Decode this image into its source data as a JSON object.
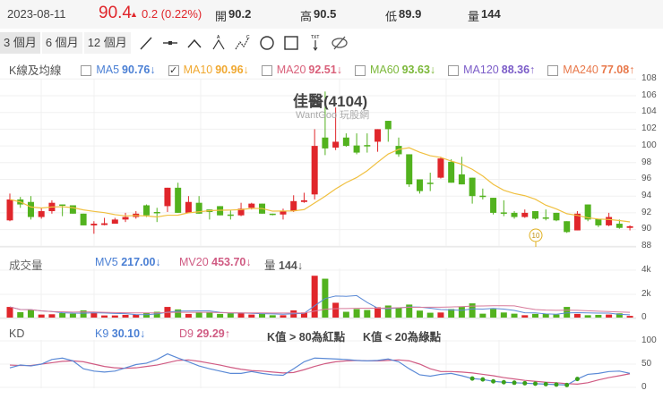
{
  "header": {
    "date": "2023-08-11",
    "price": "90.4",
    "change": "0.2 (0.22%)",
    "open_label": "開",
    "open": "90.2",
    "high_label": "高",
    "high": "90.5",
    "low_label": "低",
    "low": "89.9",
    "vol_label": "量",
    "vol": "144"
  },
  "toolbar": {
    "periods": [
      "3 個月",
      "6 個月",
      "12 個月"
    ],
    "selected": 0
  },
  "legend": {
    "title": "K線及均線",
    "items": [
      {
        "name": "MA5",
        "value": "90.76↓",
        "color": "#4a7fd4",
        "checked": false
      },
      {
        "name": "MA10",
        "value": "90.96↓",
        "color": "#f0a830",
        "checked": true
      },
      {
        "name": "MA20",
        "value": "92.51↓",
        "color": "#d9607a",
        "checked": false
      },
      {
        "name": "MA60",
        "value": "93.63↓",
        "color": "#7cb83a",
        "checked": false
      },
      {
        "name": "MA120",
        "value": "88.36↑",
        "color": "#7b5cc8",
        "checked": false
      },
      {
        "name": "MA240",
        "value": "77.08↑",
        "color": "#e8784a",
        "checked": false
      }
    ]
  },
  "chart": {
    "title": "佳醫(4104)",
    "watermark": "WantGoo 玩股網",
    "marker": "10",
    "price_ticks": [
      "108",
      "106",
      "104",
      "102",
      "100",
      "98",
      "96",
      "94",
      "92",
      "90",
      "88"
    ],
    "colors": {
      "up": "#e0262b",
      "down": "#52b21e",
      "flat": "#bbbbbb",
      "ma10": "#f0c040"
    }
  },
  "volume": {
    "title": "成交量",
    "mv5": "MV5",
    "mv5_value": "217.00↓",
    "mv20": "MV20",
    "mv20_value": "453.70↓",
    "vol_label": "量",
    "vol_value": "144↓",
    "ticks": [
      "4k",
      "2k",
      "0"
    ]
  },
  "kd": {
    "title": "KD",
    "k": "K9",
    "k_value": "30.10↓",
    "d": "D9",
    "d_value": "29.29↑",
    "note1": "K值 > 80為紅點",
    "note2": "K值 < 20為綠點",
    "ticks": [
      "100",
      "50",
      "0"
    ]
  },
  "chart_data": {
    "type": "candlestick",
    "ohlc": [
      [
        91.1,
        94.3,
        91.0,
        93.6
      ],
      [
        93.6,
        93.9,
        92.6,
        93.0
      ],
      [
        93.3,
        94.0,
        91.2,
        91.5
      ],
      [
        91.5,
        92.6,
        91.3,
        92.2
      ],
      [
        92.2,
        93.5,
        91.9,
        93.2
      ],
      [
        93.0,
        93.0,
        91.6,
        92.9
      ],
      [
        92.9,
        92.9,
        91.9,
        91.9
      ],
      [
        91.9,
        91.9,
        90.5,
        90.5
      ],
      [
        90.5,
        91.0,
        89.5,
        90.7
      ],
      [
        90.55,
        91.4,
        90.5,
        90.75
      ],
      [
        90.7,
        91.4,
        90.7,
        91.2
      ],
      [
        91.2,
        92.0,
        90.9,
        91.5
      ],
      [
        91.5,
        92.2,
        91.3,
        91.9
      ],
      [
        92.9,
        93.0,
        91.5,
        91.7
      ],
      [
        92.1,
        92.6,
        90.9,
        92.0
      ],
      [
        92.8,
        95.0,
        92.1,
        95.0
      ],
      [
        95.0,
        95.6,
        92.0,
        92.0
      ],
      [
        92.0,
        94.0,
        92.0,
        93.3
      ],
      [
        93.2,
        94.0,
        91.9,
        91.9
      ],
      [
        92.4,
        92.4,
        91.2,
        92.1
      ],
      [
        92.8,
        92.8,
        91.7,
        91.7
      ],
      [
        91.8,
        92.3,
        91.2,
        91.7
      ],
      [
        91.7,
        93.2,
        91.6,
        92.5
      ],
      [
        92.6,
        93.2,
        92.4,
        93.1
      ],
      [
        93.1,
        93.1,
        91.9,
        91.9
      ],
      [
        91.9,
        91.9,
        91.7,
        91.8
      ],
      [
        91.8,
        92.5,
        91.2,
        92.2
      ],
      [
        92.2,
        94.1,
        92.1,
        93.4
      ],
      [
        93.3,
        94.4,
        93.2,
        93.5
      ],
      [
        94.2,
        102.0,
        93.6,
        100.0
      ],
      [
        101.0,
        106.5,
        98.9,
        99.7
      ],
      [
        99.8,
        104.6,
        99.5,
        100.5
      ],
      [
        101.0,
        101.5,
        99.9,
        100.0
      ],
      [
        100.05,
        101.5,
        99.0,
        99.2
      ],
      [
        100.1,
        101.5,
        99.2,
        100.0
      ],
      [
        100.5,
        102.0,
        99.3,
        102.0
      ],
      [
        103.0,
        103.0,
        100.5,
        102.0
      ],
      [
        100.0,
        101.0,
        98.7,
        99.0
      ],
      [
        99.0,
        99.0,
        95.1,
        95.4
      ],
      [
        96.0,
        96.0,
        94.3,
        94.6
      ],
      [
        95.6,
        96.8,
        94.6,
        95.55
      ],
      [
        96.2,
        98.7,
        96.1,
        98.5
      ],
      [
        98.1,
        98.4,
        95.6,
        95.6
      ],
      [
        96.6,
        98.7,
        95.4,
        95.4
      ],
      [
        96.2,
        96.2,
        93.1,
        94.0
      ],
      [
        94.05,
        94.9,
        93.6,
        93.95
      ],
      [
        93.8,
        93.8,
        91.8,
        92.0
      ],
      [
        92.05,
        93.5,
        91.6,
        92.0
      ],
      [
        92.0,
        92.2,
        91.3,
        91.5
      ],
      [
        91.5,
        92.4,
        91.4,
        92.0
      ],
      [
        92.2,
        92.2,
        91.2,
        91.3
      ],
      [
        91.45,
        92.4,
        91.1,
        91.4
      ],
      [
        92.0,
        92.0,
        91.0,
        91.1
      ],
      [
        91.0,
        91.0,
        89.6,
        89.7
      ],
      [
        89.9,
        92.2,
        89.9,
        91.9
      ],
      [
        93.0,
        93.0,
        91.0,
        91.2
      ],
      [
        91.25,
        91.25,
        90.3,
        90.5
      ],
      [
        90.5,
        92.0,
        90.4,
        91.5
      ],
      [
        90.7,
        91.2,
        90.1,
        90.2
      ],
      [
        90.2,
        90.5,
        89.9,
        90.4
      ]
    ],
    "volume": [
      900,
      460,
      640,
      256,
      280,
      380,
      330,
      610,
      430,
      180,
      180,
      230,
      256,
      380,
      490,
      900,
      690,
      310,
      460,
      460,
      310,
      360,
      410,
      256,
      330,
      200,
      200,
      610,
      430,
      3530,
      3280,
      1250,
      490,
      720,
      640,
      870,
      1020,
      850,
      1100,
      590,
      410,
      430,
      720,
      900,
      1200,
      330,
      720,
      430,
      330,
      200,
      310,
      310,
      256,
      900,
      310,
      200,
      230,
      256,
      360,
      144
    ],
    "volume_colors": "rggrrgggrrrrrgrrgrgrgnrrggrrrrgrggrrnggg rrggggg ngrgngg rgg rgr",
    "k": [
      42,
      48,
      46,
      50,
      60,
      63,
      57,
      40,
      35,
      33,
      35,
      42,
      49,
      52,
      60,
      72,
      63,
      55,
      46,
      40,
      35,
      30,
      30,
      34,
      30,
      27,
      26,
      40,
      55,
      63,
      62,
      61,
      60,
      58,
      57,
      58,
      61,
      55,
      40,
      27,
      24,
      28,
      30,
      25,
      19,
      17,
      13,
      11,
      10,
      9,
      8,
      7,
      6,
      5,
      18,
      28,
      30,
      34,
      35,
      30.1
    ],
    "d": [
      48,
      47,
      47,
      50,
      53,
      56,
      57,
      55,
      50,
      45,
      42,
      41,
      42,
      45,
      48,
      53,
      58,
      59,
      56,
      52,
      48,
      43,
      39,
      36,
      35,
      33,
      31,
      32,
      38,
      45,
      51,
      55,
      57,
      58,
      57,
      57,
      58,
      59,
      57,
      50,
      40,
      34,
      34,
      33,
      31,
      28,
      25,
      21,
      18,
      15,
      13,
      11,
      10,
      8,
      7,
      10,
      16,
      21,
      25,
      29.29
    ],
    "price_range": [
      88,
      108
    ],
    "volume_range": [
      0,
      4000
    ],
    "kd_range": [
      0,
      100
    ]
  }
}
